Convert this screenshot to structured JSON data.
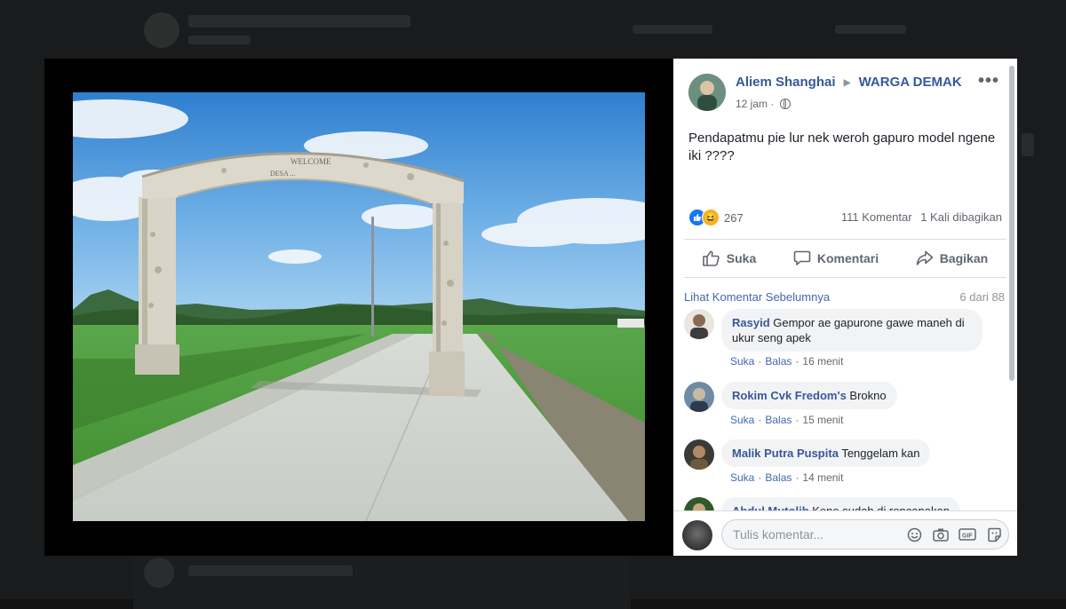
{
  "background": {
    "post_author": "Aliem Shanghai ▸ WARGA DEMAK"
  },
  "post": {
    "author": "Aliem Shanghai",
    "group": "WARGA DEMAK",
    "time": "12 jam",
    "privacy_icon": "globe-icon",
    "more_icon": "more-options-icon",
    "text": "Pendapatmu pie lur nek weroh gapuro model ngene iki ????",
    "reactions": {
      "types": [
        "like",
        "haha"
      ],
      "count": "267"
    },
    "comments_count": "111 Komentar",
    "shares_count": "1 Kali dibagikan",
    "photo": {
      "arch_text_line1": "WELCOME",
      "arch_text_line2": "DESA ..."
    }
  },
  "actions": {
    "like": "Suka",
    "comment": "Komentari",
    "share": "Bagikan"
  },
  "comments_section": {
    "previous_link": "Lihat Komentar Sebelumnya",
    "page_indicator": "6 dari 88",
    "comments": [
      {
        "name": "Rasyid",
        "text": "Gempor ae gapurone gawe maneh di ukur seng apek",
        "like": "Suka",
        "reply": "Balas",
        "time": "16 menit"
      },
      {
        "name": "Rokim Cvk Fredom's",
        "text": "Brokno",
        "like": "Suka",
        "reply": "Balas",
        "time": "15 menit"
      },
      {
        "name": "Malik Putra Puspita",
        "text": "Tenggelam kan",
        "like": "Suka",
        "reply": "Balas",
        "time": "14 menit"
      },
      {
        "name": "Abdul Mutolib",
        "text": "Kene sudah di rencanakan"
      }
    ]
  },
  "composer": {
    "placeholder": "Tulis komentar...",
    "icons": [
      "emoji-icon",
      "camera-icon",
      "gif-icon",
      "sticker-icon"
    ]
  },
  "colors": {
    "link_blue": "#365899",
    "like_blue": "#1877f2",
    "haha_yellow": "#f7b125",
    "bubble_gray": "#f2f3f5"
  }
}
